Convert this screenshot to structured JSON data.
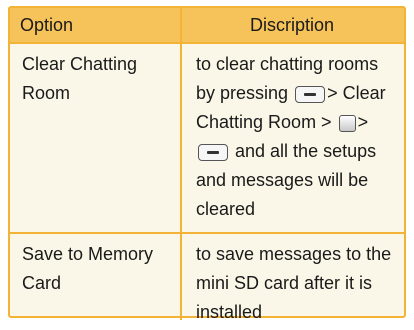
{
  "header": {
    "option_label": "Option",
    "description_label": "Discription"
  },
  "rows": [
    {
      "option": "Clear Chatting Room",
      "description": {
        "part1": "to clear chatting rooms by pressing",
        "part2": "> Clear Chatting Room >",
        "part3": ">",
        "part4": "and all the setups and messages will be cleared"
      },
      "icons": [
        "softkey-icon",
        "ok-key-icon",
        "softkey-icon"
      ]
    },
    {
      "option": "Save to Memory Card",
      "description": {
        "text": "to save messages to the mini SD card after it is installed"
      }
    }
  ],
  "colors": {
    "border": "#f2b336",
    "header_bg": "#f5c35a",
    "body_bg": "#fbf7e8"
  }
}
